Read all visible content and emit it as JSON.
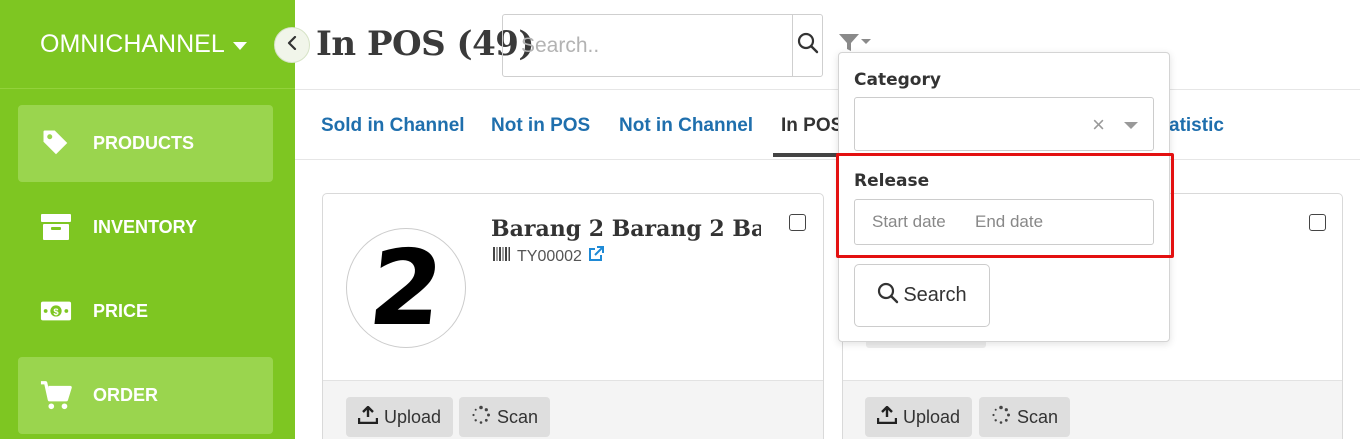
{
  "sidebar": {
    "brand": "OMNICHANNEL",
    "items": [
      {
        "label": "PRODUCTS",
        "active": true
      },
      {
        "label": "INVENTORY",
        "active": false
      },
      {
        "label": "PRICE",
        "active": false
      },
      {
        "label": "ORDER",
        "active": true
      }
    ]
  },
  "header": {
    "title": "In POS (49)",
    "search_placeholder": "Search.."
  },
  "tabs": [
    {
      "label": "Sold in Channel"
    },
    {
      "label": "Not in POS"
    },
    {
      "label": "Not in Channel"
    },
    {
      "label": "In POS",
      "active": true
    },
    {
      "label": "Statistic"
    }
  ],
  "cards": [
    {
      "title": "Barang 2 Barang 2 Ba...",
      "sku": "TY00002",
      "thumb_text": "2",
      "upload_label": "Upload",
      "scan_label": "Scan"
    },
    {
      "upload_label": "Upload",
      "scan_label": "Scan"
    }
  ],
  "filter": {
    "category_label": "Category",
    "category_value": "",
    "clear_symbol": "×",
    "release_label": "Release",
    "start_placeholder": "Start date",
    "end_placeholder": "End date",
    "search_label": "Search"
  },
  "colors": {
    "sidebar": "#7ec622",
    "tab_link": "#1f6fad",
    "highlight": "#e31010"
  }
}
